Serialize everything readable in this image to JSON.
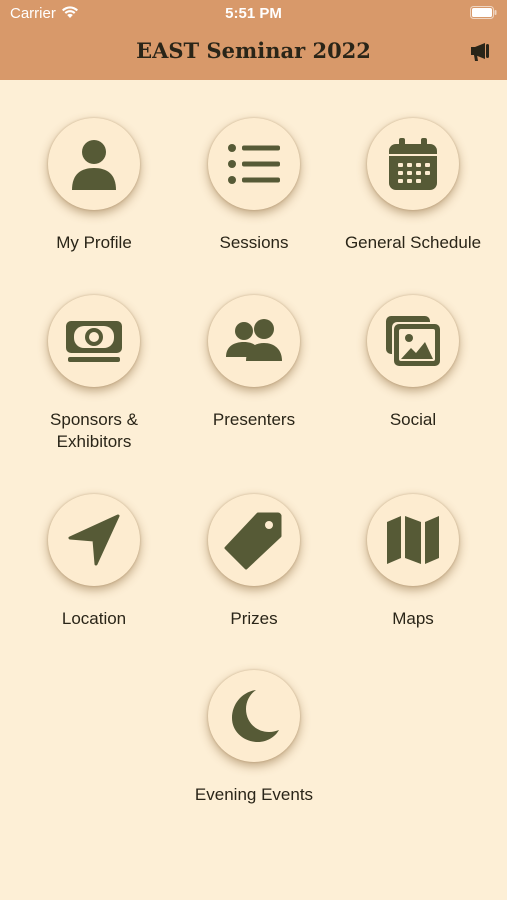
{
  "status": {
    "carrier": "Carrier",
    "time": "5:51 PM"
  },
  "header": {
    "title": "EAST Seminar 2022",
    "action_icon": "megaphone-icon"
  },
  "colors": {
    "header_bg": "#d8996a",
    "page_bg": "#fdefd6",
    "icon": "#565a36",
    "circle_bg": "#fdecd0"
  },
  "tiles": [
    {
      "label": "My Profile",
      "icon": "user-icon"
    },
    {
      "label": "Sessions",
      "icon": "list-icon"
    },
    {
      "label": "General Schedule",
      "icon": "calendar-icon"
    },
    {
      "label": "Sponsors & Exhibitors",
      "icon": "money-icon"
    },
    {
      "label": "Presenters",
      "icon": "users-icon"
    },
    {
      "label": "Social",
      "icon": "images-icon"
    },
    {
      "label": "Location",
      "icon": "location-arrow-icon"
    },
    {
      "label": "Prizes",
      "icon": "tag-icon"
    },
    {
      "label": "Maps",
      "icon": "map-icon"
    },
    {
      "label": "Evening Events",
      "icon": "moon-icon"
    }
  ]
}
